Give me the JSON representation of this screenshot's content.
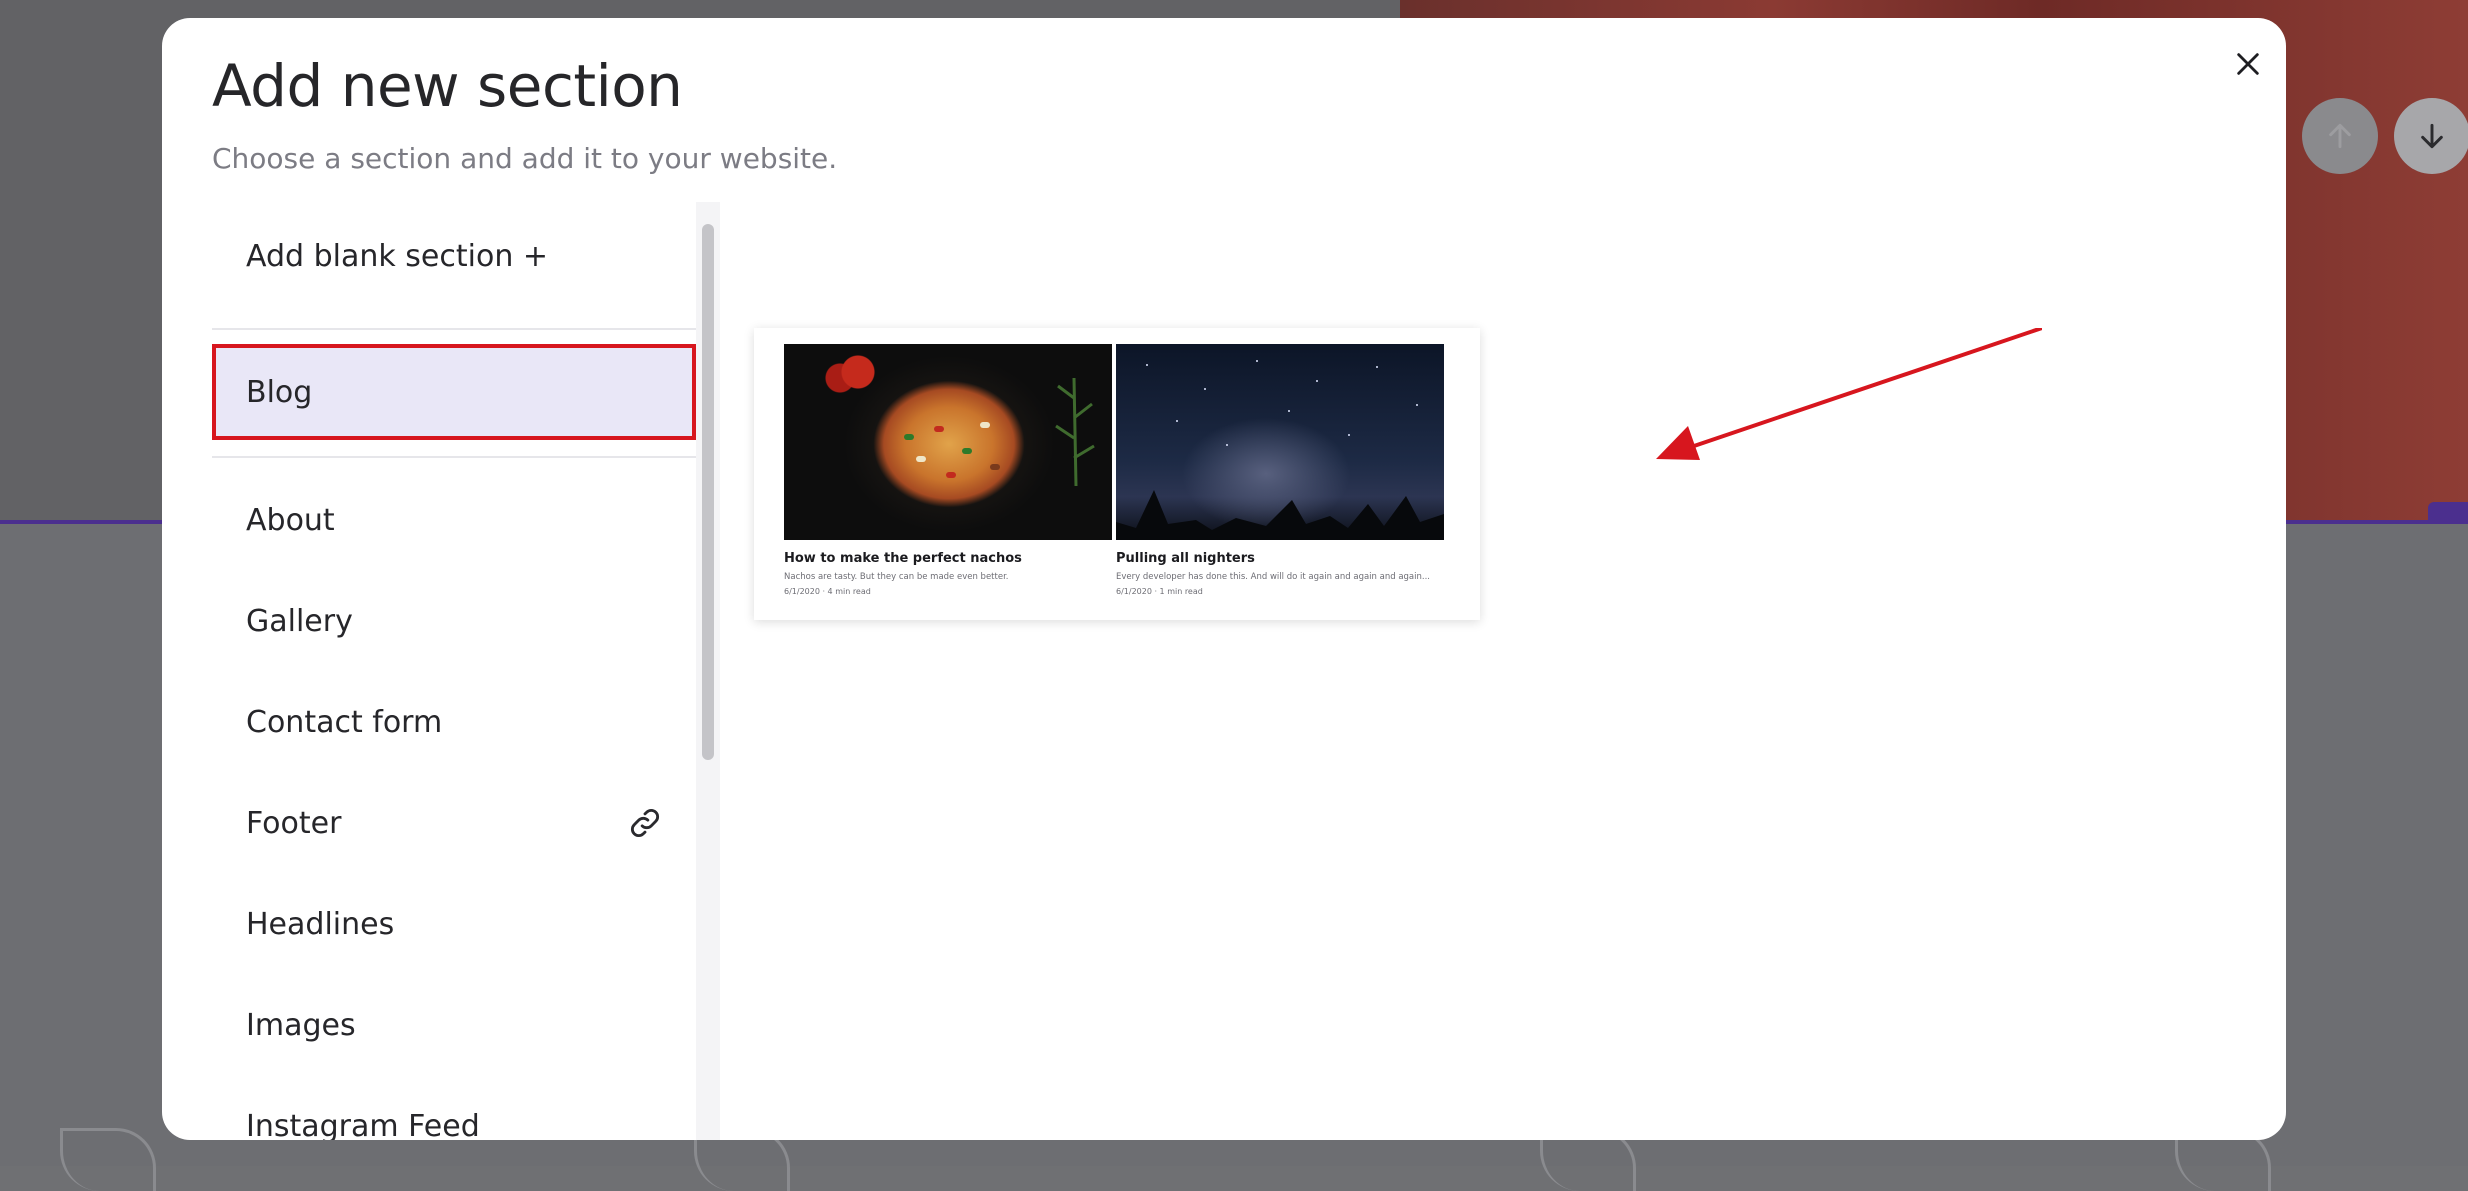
{
  "modal": {
    "title": "Add new section",
    "subtitle": "Choose a section and add it to your website.",
    "close_icon": "close-icon"
  },
  "sidebar": {
    "items": [
      {
        "label": "Add blank section +",
        "active": false
      },
      {
        "label": "Blog",
        "active": true
      },
      {
        "label": "About",
        "active": false
      },
      {
        "label": "Gallery",
        "active": false
      },
      {
        "label": "Contact form",
        "active": false
      },
      {
        "label": "Footer",
        "active": false,
        "icon": "link-icon"
      },
      {
        "label": "Headlines",
        "active": false
      },
      {
        "label": "Images",
        "active": false
      },
      {
        "label": "Instagram Feed",
        "active": false
      }
    ]
  },
  "preview": {
    "posts": [
      {
        "title": "How to make the perfect nachos",
        "excerpt": "Nachos are tasty. But they can be made even better.",
        "meta": "6/1/2020 · 4 min read",
        "image": "nachos-photo"
      },
      {
        "title": "Pulling all nighters",
        "excerpt": "Every developer has done this. And will do it again and again and again...",
        "meta": "6/1/2020 · 1 min read",
        "image": "night-sky-photo"
      }
    ]
  },
  "background": {
    "move_up_icon": "arrow-up-icon",
    "move_down_icon": "arrow-down-icon"
  },
  "colors": {
    "active_item_bg": "#e9e7f7",
    "highlight_border": "#d7161e",
    "annotation_arrow": "#d7161e",
    "brand_purple": "#4b2f8e"
  }
}
